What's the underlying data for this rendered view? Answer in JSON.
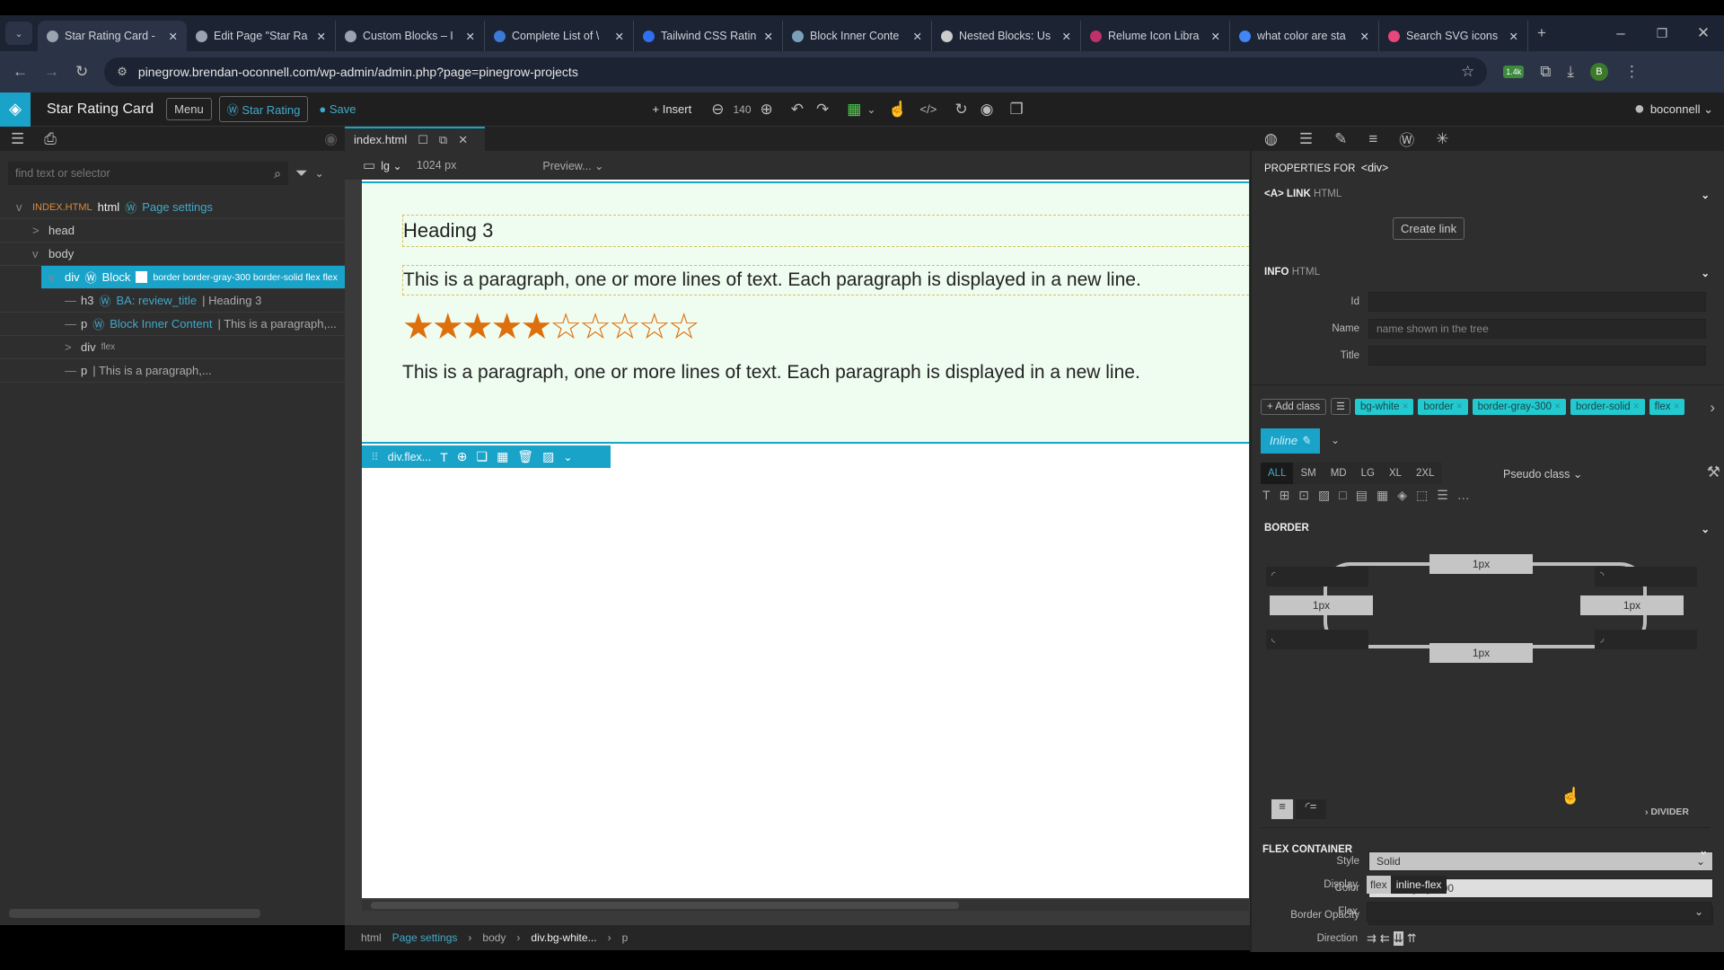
{
  "browser": {
    "tabs": [
      {
        "label": "Star Rating Card -",
        "active": true,
        "favicon": "globe-icon",
        "color": "#9aa4b0"
      },
      {
        "label": "Edit Page \"Star Ra",
        "favicon": "globe-icon",
        "color": "#9aa4b0"
      },
      {
        "label": "Custom Blocks – I",
        "favicon": "globe-icon",
        "color": "#9aa4b0"
      },
      {
        "label": "Complete List of \\",
        "favicon": "telescope-icon",
        "color": "#3b7bd6"
      },
      {
        "label": "Tailwind CSS Ratin",
        "favicon": "circle-icon",
        "color": "#2f6ff0"
      },
      {
        "label": "Block Inner Conte",
        "favicon": "pinegrow-icon",
        "color": "#7aa0b8"
      },
      {
        "label": "Nested Blocks: Us",
        "favicon": "wordpress-icon",
        "color": "#ccc"
      },
      {
        "label": "Relume Icon Libra",
        "favicon": "relume-icon",
        "color": "#c0306a"
      },
      {
        "label": "what color are sta",
        "favicon": "google-icon",
        "color": "#4285f4"
      },
      {
        "label": "Search SVG icons",
        "favicon": "svg-icon",
        "color": "#e8467c"
      }
    ],
    "url": "pinegrow.brendan-oconnell.com/wp-admin/admin.php?page=pinegrow-projects",
    "extension_badge": "1.4k",
    "profile_initial": "B"
  },
  "app": {
    "title": "Star Rating Card",
    "menu": "Menu",
    "wp_block": "Star Rating",
    "save": "Save",
    "insert": "Insert",
    "zoom": "140",
    "user": "boconnell"
  },
  "left": {
    "search_placeholder": "find text or selector",
    "tree": [
      {
        "tag": "INDEX.HTML",
        "sub": "html",
        "wp": "Page settings",
        "depth": 0,
        "toggle": "v"
      },
      {
        "tag": "head",
        "depth": 1,
        "toggle": ">"
      },
      {
        "tag": "body",
        "depth": 1,
        "toggle": "v"
      },
      {
        "tag": "div",
        "wp": "Block",
        "extra": "border border-gray-300 border-solid flex flex",
        "depth": 2,
        "toggle": "v",
        "selected": true
      },
      {
        "tag": "h3",
        "wp": "BA: review_title",
        "extra": "| Heading 3",
        "depth": 3,
        "toggle": "—"
      },
      {
        "tag": "p",
        "wp": "Block Inner Content",
        "extra": "| This is a paragraph,...",
        "depth": 3,
        "toggle": "—"
      },
      {
        "tag": "div",
        "small": "flex",
        "depth": 3,
        "toggle": ">"
      },
      {
        "tag": "p",
        "extra": "| This is a paragraph,...",
        "depth": 3,
        "toggle": "—"
      }
    ]
  },
  "canvas": {
    "file_tab": "index.html",
    "device": "lg",
    "width": "1024 px",
    "preview": "Preview...",
    "heading": "Heading 3",
    "paragraph1": "This is a paragraph, one or more lines of text. Each paragraph is displayed in a new line.",
    "paragraph2": "This is a paragraph, one or more lines of text. Each paragraph is displayed in a new line.",
    "rating": {
      "filled": 5,
      "total": 10,
      "color": "#dd6f0c"
    },
    "element_label": "div.flex...",
    "breadcrumb": [
      "html",
      "Page settings",
      "body",
      "div.bg-white...",
      "p"
    ]
  },
  "props": {
    "title": "PROPERTIES FOR",
    "tag": "<div>",
    "link_section": "<A> LINK",
    "link_sub": "HTML",
    "create_link": "Create link",
    "info_section": "INFO",
    "info_sub": "HTML",
    "id_label": "Id",
    "name_label": "Name",
    "name_placeholder": "name shown in the tree",
    "title_label": "Title",
    "add_class": "+ Add class",
    "classes": [
      "bg-white",
      "border",
      "border-gray-300",
      "border-solid",
      "flex"
    ],
    "inline": "Inline",
    "breakpoints": [
      "ALL",
      "SM",
      "MD",
      "LG",
      "XL",
      "2XL"
    ],
    "pseudo": "Pseudo class",
    "border_section": "BORDER",
    "border_top": "1px",
    "border_left": "1px",
    "border_right": "1px",
    "border_bottom": "1px",
    "style_label": "Style",
    "style_value": "Solid",
    "color_label": "Color",
    "color_value": "border-gray-300",
    "opacity_label": "Border Opacity",
    "divider": "DIVIDER",
    "flex_section": "FLEX CONTAINER",
    "display_label": "Display",
    "display_options": [
      "flex",
      "inline-flex"
    ],
    "flex_label": "Flex",
    "direction_label": "Direction"
  }
}
